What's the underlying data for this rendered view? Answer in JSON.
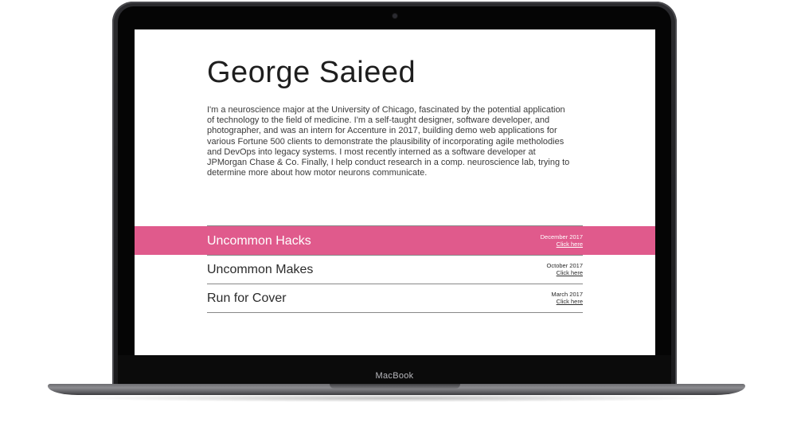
{
  "device": {
    "brand_label": "MacBook"
  },
  "profile": {
    "name": "George Saieed",
    "bio": "I'm a neuroscience major at the University of Chicago, fascinated by the potential application of technology to the field of medicine. I'm a self-taught designer, software developer, and photographer, and was an intern for Accenture in 2017, building demo web applications for various Fortune 500 clients to demonstrate the plausibility of incorporating agile metholodies and DevOps into legacy systems. I most recently interned as a software developer at JPMorgan Chase & Co. Finally, I help conduct research in a comp. neuroscience lab, trying to determine more about how motor neurons communicate."
  },
  "projects": [
    {
      "title": "Uncommon Hacks",
      "date": "December 2017",
      "link_label": "Click here",
      "highlighted": true
    },
    {
      "title": "Uncommon Makes",
      "date": "October 2017",
      "link_label": "Click here",
      "highlighted": false
    },
    {
      "title": "Run for Cover",
      "date": "March 2017",
      "link_label": "Click here",
      "highlighted": false
    }
  ],
  "colors": {
    "highlight": "#e05a8c",
    "device_body": "#1a1a1c"
  }
}
